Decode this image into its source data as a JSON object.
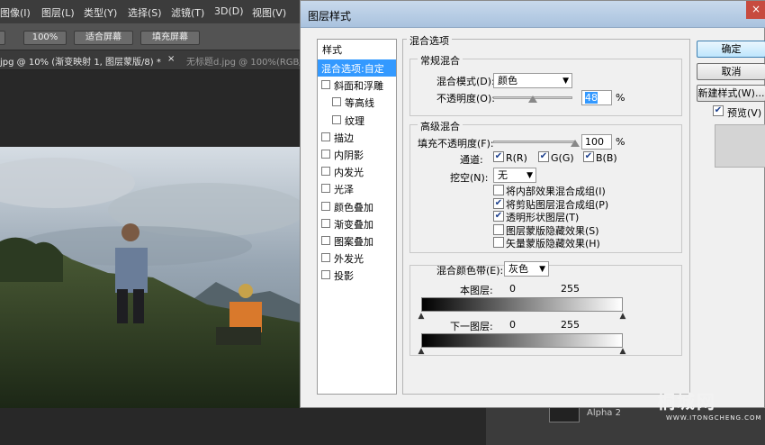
{
  "ps": {
    "menu": [
      "图像(I)",
      "图层(L)",
      "类型(Y)",
      "选择(S)",
      "滤镜(T)",
      "3D(D)",
      "视图(V)"
    ],
    "options": {
      "zoom": "100%",
      "fit": "适合屏幕",
      "fill": "填充屏幕"
    },
    "tabs": [
      "jpg @ 10% (渐变映射 1, 图层蒙版/8) *",
      "无标题d.jpg @ 100%(RGB/"
    ],
    "tab_close": "×",
    "layer_peek": "Alpha 2"
  },
  "dialog": {
    "title": "图层样式",
    "close": "×",
    "styles_header": "样式",
    "styles": [
      {
        "label": "混合选项:自定",
        "active": true,
        "checkbox": false,
        "indent": false
      },
      {
        "label": "斜面和浮雕",
        "active": false,
        "checkbox": true,
        "indent": false
      },
      {
        "label": "等高线",
        "active": false,
        "checkbox": true,
        "indent": true
      },
      {
        "label": "纹理",
        "active": false,
        "checkbox": true,
        "indent": true
      },
      {
        "label": "描边",
        "active": false,
        "checkbox": true,
        "indent": false
      },
      {
        "label": "内阴影",
        "active": false,
        "checkbox": true,
        "indent": false
      },
      {
        "label": "内发光",
        "active": false,
        "checkbox": true,
        "indent": false
      },
      {
        "label": "光泽",
        "active": false,
        "checkbox": true,
        "indent": false
      },
      {
        "label": "颜色叠加",
        "active": false,
        "checkbox": true,
        "indent": false
      },
      {
        "label": "渐变叠加",
        "active": false,
        "checkbox": true,
        "indent": false
      },
      {
        "label": "图案叠加",
        "active": false,
        "checkbox": true,
        "indent": false
      },
      {
        "label": "外发光",
        "active": false,
        "checkbox": true,
        "indent": false
      },
      {
        "label": "投影",
        "active": false,
        "checkbox": true,
        "indent": false
      }
    ],
    "blend_options_title": "混合选项",
    "general": {
      "title": "常规混合",
      "mode_label": "混合模式(D):",
      "mode_value": "颜色",
      "opacity_label": "不透明度(O):",
      "opacity_value": "48",
      "opacity_unit": "%"
    },
    "advanced": {
      "title": "高级混合",
      "fill_label": "填充不透明度(F):",
      "fill_value": "100",
      "fill_unit": "%",
      "channels_label": "通道:",
      "channels": [
        {
          "label": "R(R)",
          "checked": true
        },
        {
          "label": "G(G)",
          "checked": true
        },
        {
          "label": "B(B)",
          "checked": true
        }
      ],
      "knockout_label": "挖空(N):",
      "knockout_value": "无",
      "options": [
        {
          "label": "将内部效果混合成组(I)",
          "checked": false
        },
        {
          "label": "将剪贴图层混合成组(P)",
          "checked": true
        },
        {
          "label": "透明形状图层(T)",
          "checked": true
        },
        {
          "label": "图层蒙版隐藏效果(S)",
          "checked": false
        },
        {
          "label": "矢量蒙版隐藏效果(H)",
          "checked": false
        }
      ]
    },
    "blend_if": {
      "label": "混合颜色带(E):",
      "value": "灰色",
      "this_layer_label": "本图层:",
      "this_layer_min": "0",
      "this_layer_max": "255",
      "under_layer_label": "下一图层:",
      "under_layer_min": "0",
      "under_layer_max": "255"
    },
    "buttons": {
      "ok": "确定",
      "cancel": "取消",
      "new_style": "新建样式(W)...",
      "preview": "预览(V)"
    },
    "preview_checked": true
  },
  "watermark": {
    "logo": "桐城网",
    "url": "WWW.ITONGCHENG.COM"
  }
}
